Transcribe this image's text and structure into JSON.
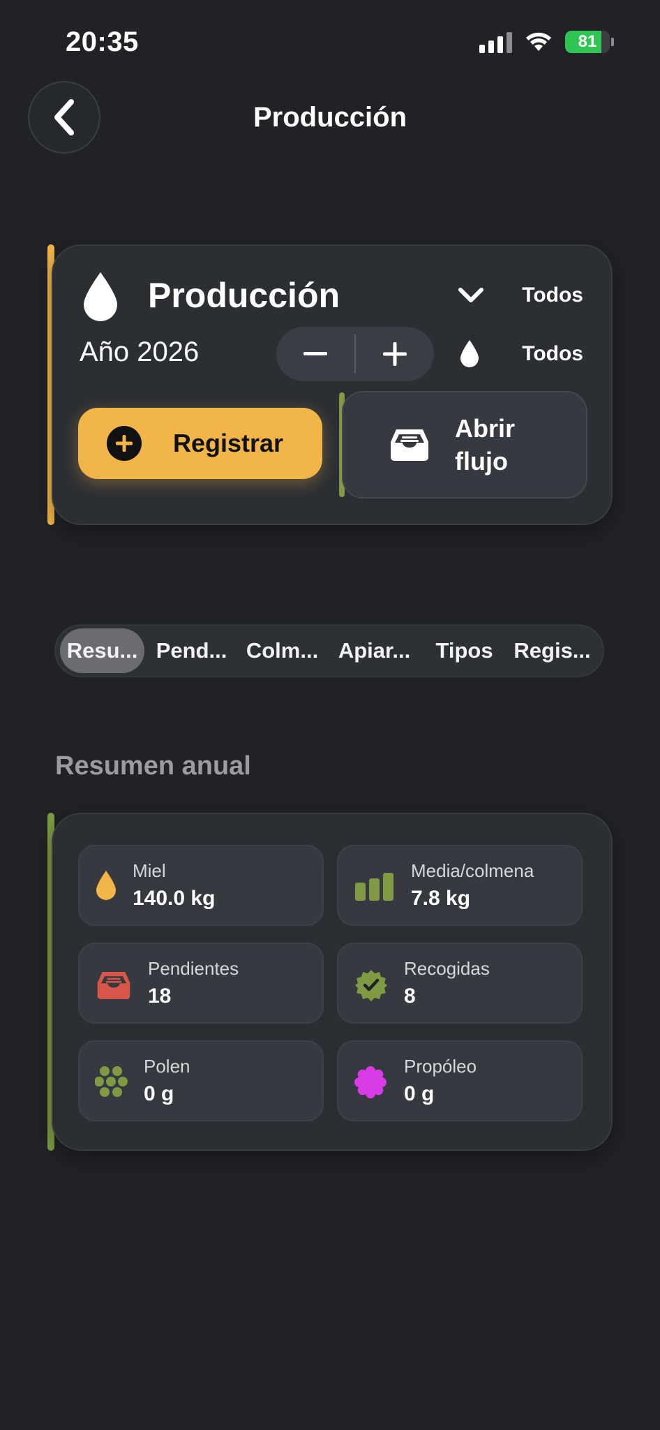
{
  "status_bar": {
    "time": "20:35",
    "battery": "81"
  },
  "header": {
    "title": "Producción"
  },
  "production_card": {
    "title": "Producción",
    "filter_1_label": "Todos",
    "filter_2_label": "Todos",
    "year_label": "Año 2026",
    "register_label": "Registrar",
    "open_flow_label": "Abrir flujo"
  },
  "tabs": [
    {
      "label": "Resu...",
      "active": true
    },
    {
      "label": "Pend..."
    },
    {
      "label": "Colm..."
    },
    {
      "label": "Apiar..."
    },
    {
      "label": "Tipos"
    },
    {
      "label": "Regis..."
    }
  ],
  "summary": {
    "title": "Resumen anual",
    "stats": [
      {
        "label": "Miel",
        "value": "140.0 kg",
        "icon": "honey-drop-icon"
      },
      {
        "label": "Media/colmena",
        "value": "7.8 kg",
        "icon": "bar-chart-icon"
      },
      {
        "label": "Pendientes",
        "value": "18",
        "icon": "tray-icon"
      },
      {
        "label": "Recogidas",
        "value": "8",
        "icon": "check-badge-icon"
      },
      {
        "label": "Polen",
        "value": "0 g",
        "icon": "pollen-icon"
      },
      {
        "label": "Propóleo",
        "value": "0 g",
        "icon": "propolis-icon"
      }
    ]
  },
  "colors": {
    "background": "#202226",
    "accent_yellow": "#f1b54a",
    "accent_green": "#7f9a43",
    "red": "#d9574a",
    "magenta": "#d93be6"
  }
}
